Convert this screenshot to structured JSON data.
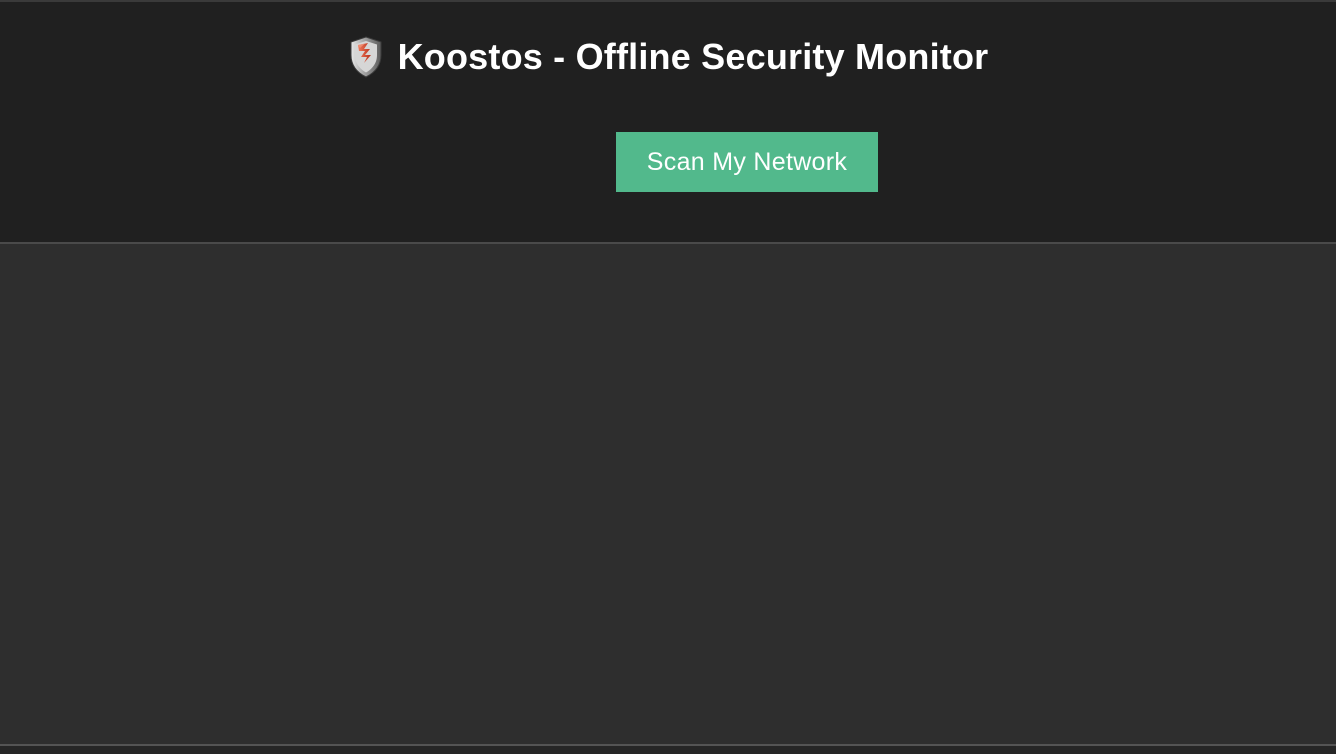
{
  "header": {
    "title": "Koostos - Offline Security Monitor",
    "logo_icon": "shield-icon",
    "scan_button_label": "Scan My Network"
  },
  "colors": {
    "header_bg": "#202020",
    "main_bg": "#2e2e2e",
    "accent": "#52b98c",
    "title_text": "#ffffff",
    "shield_red": "#d9533c",
    "shield_silver": "#a8a8a8"
  }
}
